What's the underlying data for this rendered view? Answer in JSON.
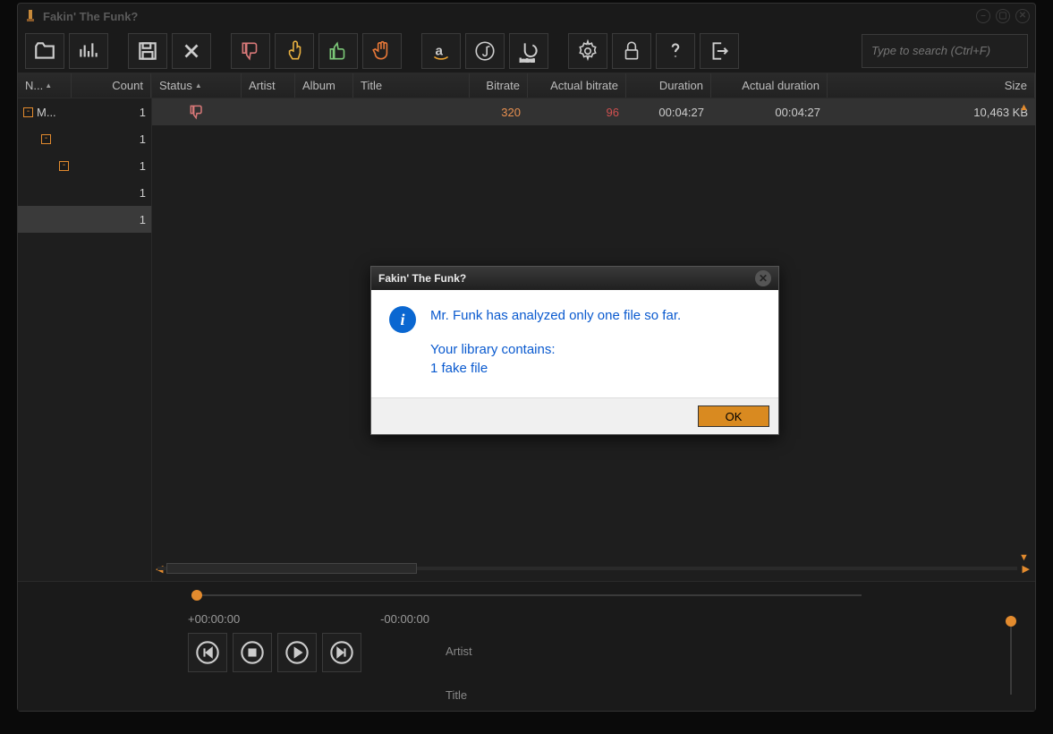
{
  "window": {
    "title": "Fakin' The Funk?"
  },
  "toolbar": {
    "search_placeholder": "Type to search (Ctrl+F)"
  },
  "tree": {
    "headers": {
      "name": "N...",
      "count": "Count"
    },
    "rows": [
      {
        "depth": 0,
        "expander": "-",
        "label": "M...",
        "count": "1"
      },
      {
        "depth": 1,
        "expander": "-",
        "label": "",
        "count": "1"
      },
      {
        "depth": 2,
        "expander": "-",
        "label": "",
        "count": "1"
      },
      {
        "depth": 3,
        "expander": "",
        "label": "",
        "count": "1"
      },
      {
        "depth": 4,
        "expander": "",
        "label": "",
        "count": "1",
        "selected": true
      }
    ]
  },
  "grid": {
    "headers": {
      "status": "Status",
      "artist": "Artist",
      "album": "Album",
      "title": "Title",
      "bitrate": "Bitrate",
      "actual_bitrate": "Actual bitrate",
      "duration": "Duration",
      "actual_duration": "Actual duration",
      "size": "Size"
    },
    "rows": [
      {
        "status_icon": "thumb-down",
        "artist": "",
        "album": "",
        "title": "",
        "bitrate": "320",
        "actual_bitrate": "96",
        "duration": "00:04:27",
        "actual_duration": "00:04:27",
        "size": "10,463 KB"
      }
    ]
  },
  "player": {
    "elapsed": "+00:00:00",
    "remaining": "-00:00:00",
    "artist_label": "Artist",
    "title_label": "Title"
  },
  "dialog": {
    "title": "Fakin' The Funk?",
    "line1": "Mr. Funk has analyzed only one file so far.",
    "line2": "Your library contains:",
    "line3": "1 fake file",
    "ok": "OK"
  }
}
